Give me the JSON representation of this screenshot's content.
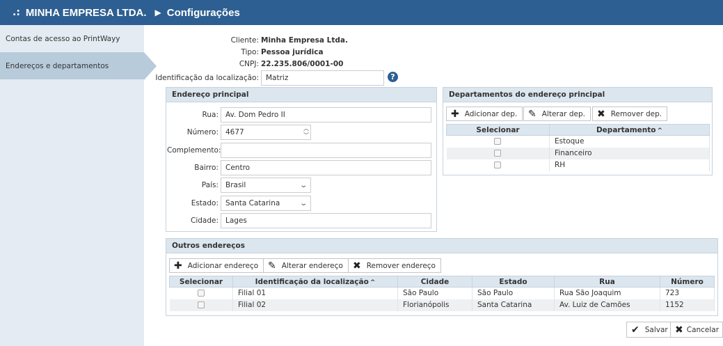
{
  "header": {
    "prefix": ".:",
    "company": "MINHA EMPRESA LTDA.",
    "separator": "▶",
    "title": "Configurações"
  },
  "sidebar": {
    "items": [
      {
        "label": "Contas de acesso ao PrintWayy"
      },
      {
        "label": "Endereços e departamentos"
      }
    ]
  },
  "client": {
    "cliente_label": "Cliente:",
    "cliente": "Minha Empresa Ltda.",
    "tipo_label": "Tipo:",
    "tipo": "Pessoa jurídica",
    "cnpj_label": "CNPJ:",
    "cnpj": "22.235.806/0001-00",
    "loc_label": "Identificação da localização:",
    "loc_value": "Matriz"
  },
  "help_icon": "?",
  "endereco": {
    "title": "Endereço principal",
    "rua_label": "Rua:",
    "rua": "Av. Dom Pedro II",
    "numero_label": "Número:",
    "numero": "4677",
    "complemento_label": "Complemento:",
    "complemento": "",
    "bairro_label": "Bairro:",
    "bairro": "Centro",
    "pais_label": "País:",
    "pais": "Brasil",
    "estado_label": "Estado:",
    "estado": "Santa Catarina",
    "cidade_label": "Cidade:",
    "cidade": "Lages"
  },
  "departamentos": {
    "title": "Departamentos do endereço principal",
    "add_label": "Adicionar dep.",
    "edit_label": "Alterar dep.",
    "remove_label": "Remover dep.",
    "col_select": "Selecionar",
    "col_dep": "Departamento",
    "rows": [
      {
        "name": "Estoque"
      },
      {
        "name": "Financeiro"
      },
      {
        "name": "RH"
      }
    ]
  },
  "outros": {
    "title": "Outros endereços",
    "add_label": "Adicionar endereço",
    "edit_label": "Alterar endereço",
    "remove_label": "Remover endereço",
    "columns": {
      "select": "Selecionar",
      "loc": "Identificação da localização",
      "cidade": "Cidade",
      "estado": "Estado",
      "rua": "Rua",
      "numero": "Número"
    },
    "rows": [
      {
        "loc": "Filial 01",
        "cidade": "São Paulo",
        "estado": "São Paulo",
        "rua": "Rua São Joaquim",
        "numero": "723"
      },
      {
        "loc": "Filial 02",
        "cidade": "Florianópolis",
        "estado": "Santa Catarina",
        "rua": "Av. Luiz de Camões",
        "numero": "1152"
      }
    ]
  },
  "footer": {
    "save_label": "Salvar",
    "cancel_label": "Cancelar"
  },
  "colors": {
    "header_bg": "#2d5f92",
    "sidebar_bg": "#e4ebf2",
    "sidebar_active": "#b8cbdb",
    "panel_head": "#dce6ef"
  }
}
